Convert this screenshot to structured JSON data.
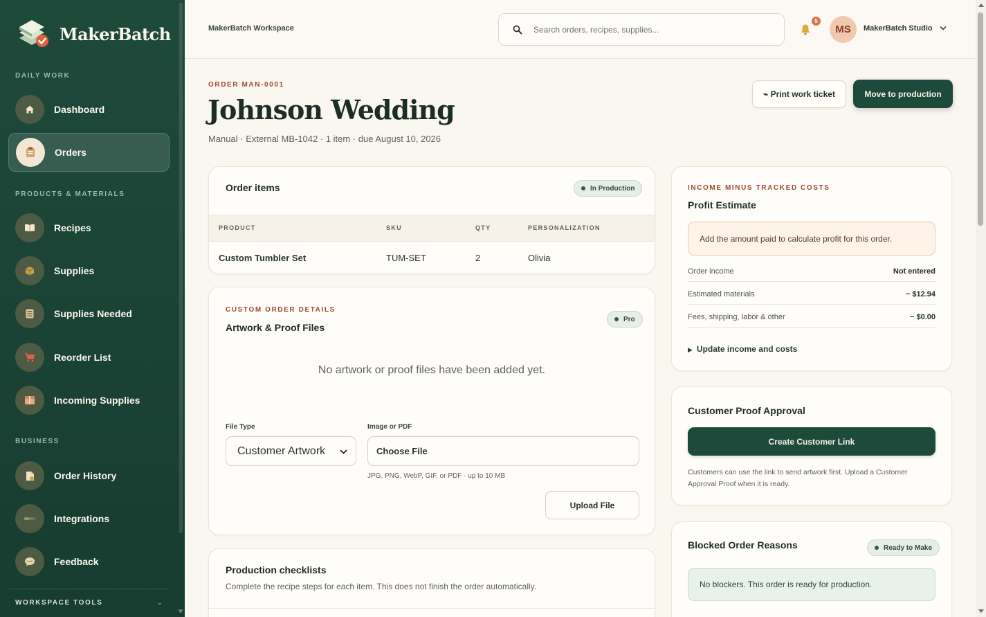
{
  "brand": {
    "name": "MakerBatch"
  },
  "sidebar": {
    "sections": {
      "daily": "DAILY WORK",
      "products": "PRODUCTS & MATERIALS",
      "business": "BUSINESS",
      "tools": "WORKSPACE TOOLS"
    },
    "items": [
      {
        "label": "Dashboard",
        "icon": "home-icon"
      },
      {
        "label": "Orders",
        "icon": "clipboard-icon",
        "active": true
      },
      {
        "label": "Recipes",
        "icon": "book-icon"
      },
      {
        "label": "Supplies",
        "icon": "box-icon"
      },
      {
        "label": "Supplies Needed",
        "icon": "list-icon"
      },
      {
        "label": "Reorder List",
        "icon": "cart-icon"
      },
      {
        "label": "Incoming Supplies",
        "icon": "package-icon"
      },
      {
        "label": "Order History",
        "icon": "document-icon"
      },
      {
        "label": "Integrations",
        "icon": "plug-icon"
      },
      {
        "label": "Feedback",
        "icon": "chat-icon"
      }
    ]
  },
  "header": {
    "workspace": "MakerBatch Workspace",
    "search_placeholder": "Search orders, recipes, supplies...",
    "notification_count": "5",
    "avatar_initials": "MS",
    "user_name": "MakerBatch Studio"
  },
  "order": {
    "eyebrow": "ORDER MAN-0001",
    "title": "Johnson Wedding",
    "subtitle": "Manual · External MB-1042 · 1 item · due August 10, 2026",
    "print_label": "⌁ Print work ticket",
    "move_label": "Move to production"
  },
  "items": {
    "title": "Order items",
    "status": "In Production",
    "columns": [
      "PRODUCT",
      "SKU",
      "QTY",
      "PERSONALIZATION"
    ],
    "rows": [
      {
        "product": "Custom Tumbler Set",
        "sku": "TUM-SET",
        "qty": "2",
        "personalization": "Olivia"
      }
    ]
  },
  "artwork": {
    "eyebrow": "CUSTOM ORDER DETAILS",
    "title": "Artwork & Proof Files",
    "badge": "Pro",
    "empty": "No artwork or proof files have been added yet.",
    "file_type_label": "File Type",
    "file_type_value": "Customer Artwork",
    "file_label": "Image or PDF",
    "file_button": "Choose File",
    "file_hint": "JPG, PNG, WebP, GIF, or PDF · up to 10 MB",
    "upload_label": "Upload File"
  },
  "checklists": {
    "title": "Production checklists",
    "subtitle": "Complete the recipe steps for each item. This does not finish the order automatically."
  },
  "profit": {
    "eyebrow": "INCOME MINUS TRACKED COSTS",
    "title": "Profit Estimate",
    "notice": "Add the amount paid to calculate profit for this order.",
    "rows": [
      {
        "label": "Order income",
        "value": "Not entered"
      },
      {
        "label": "Estimated materials",
        "value": "− $12.94"
      },
      {
        "label": "Fees, shipping, labor & other",
        "value": "− $0.00"
      }
    ],
    "update": "Update income and costs"
  },
  "proof": {
    "title": "Customer Proof Approval",
    "button": "Create Customer Link",
    "text": "Customers can use the link to send artwork first. Upload a Customer Approval Proof when it is ready."
  },
  "blocked": {
    "title": "Blocked Order Reasons",
    "badge": "Ready to Make",
    "message": "No blockers. This order is ready for production."
  },
  "colors": {
    "sidebar": "#1e4a3b",
    "primary_button": "#1e4a3b",
    "accent": "#a04a2c",
    "background": "#faf6f0"
  }
}
